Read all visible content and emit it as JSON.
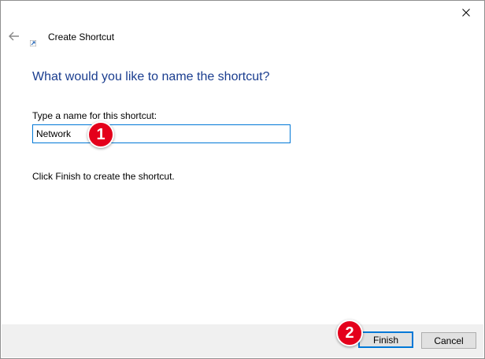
{
  "window": {
    "title": "Create Shortcut",
    "close_icon": "close-icon",
    "back_icon": "back-arrow-icon",
    "title_icon": "shortcut-icon"
  },
  "main": {
    "heading": "What would you like to name the shortcut?",
    "field_label": "Type a name for this shortcut:",
    "name_value": "Network",
    "instruction": "Click Finish to create the shortcut."
  },
  "footer": {
    "finish_label": "Finish",
    "cancel_label": "Cancel"
  },
  "annotations": {
    "marker_1": "1",
    "marker_2": "2",
    "marker_color": "#e4001b"
  },
  "colors": {
    "heading": "#1a3d8f",
    "focus_border": "#0078d7",
    "footer_bg": "#f0f0f0"
  }
}
